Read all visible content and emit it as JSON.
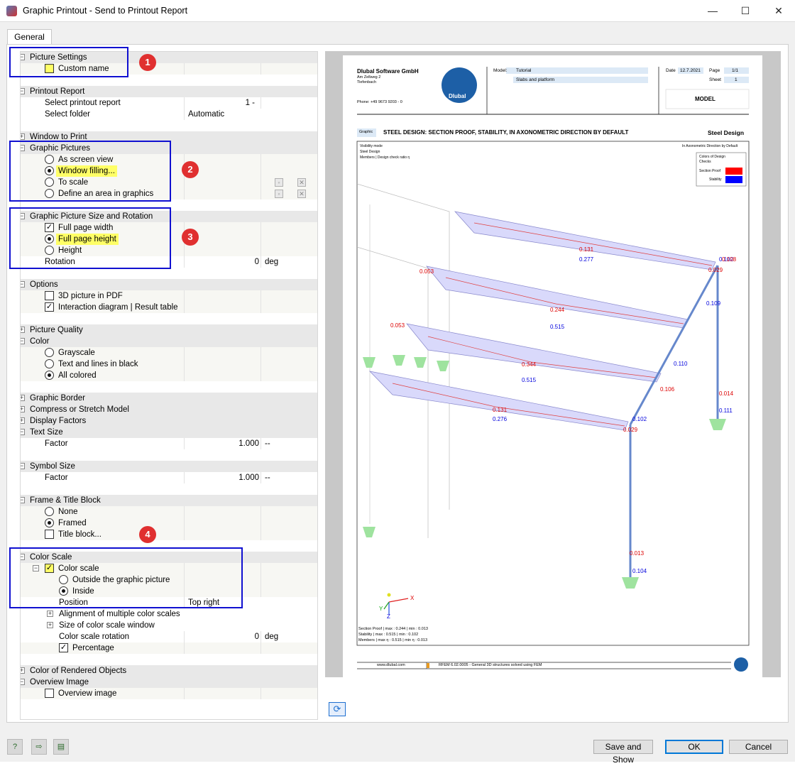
{
  "window": {
    "title": "Graphic Printout - Send to Printout Report",
    "minimize": "—",
    "maximize": "☐",
    "close": "✕"
  },
  "tab": "General",
  "tree": {
    "picture_settings": "Picture Settings",
    "custom_name": "Custom name",
    "printout_report": "Printout Report",
    "select_printout_report": "Select printout report",
    "select_printout_report_value": "1 -",
    "select_folder": "Select folder",
    "select_folder_value": "Automatic",
    "window_to_print": "Window to Print",
    "graphic_pictures": "Graphic Pictures",
    "as_screen_view": "As screen view",
    "window_filling": "Window filling...",
    "to_scale": "To scale",
    "define_area": "Define an area in graphics",
    "size_rotation": "Graphic Picture Size and Rotation",
    "full_page_width": "Full page width",
    "full_page_height": "Full page height",
    "height": "Height",
    "rotation": "Rotation",
    "rotation_value": "0",
    "rotation_unit": "deg",
    "options": "Options",
    "pdf_3d": "3D picture in PDF",
    "interaction_diagram": "Interaction diagram | Result table",
    "picture_quality": "Picture Quality",
    "color": "Color",
    "grayscale": "Grayscale",
    "text_lines_black": "Text and lines in black",
    "all_colored": "All colored",
    "graphic_border": "Graphic Border",
    "compress_stretch": "Compress or Stretch Model",
    "display_factors": "Display Factors",
    "text_size": "Text Size",
    "text_factor": "Factor",
    "text_factor_value": "1.000",
    "text_factor_unit": "--",
    "symbol_size": "Symbol Size",
    "symbol_factor": "Factor",
    "symbol_factor_value": "1.000",
    "symbol_factor_unit": "--",
    "frame_title_block": "Frame & Title Block",
    "none": "None",
    "framed": "Framed",
    "title_block": "Title block...",
    "color_scale_section": "Color Scale",
    "color_scale": "Color scale",
    "outside_graphic": "Outside the graphic picture",
    "inside": "Inside",
    "position": "Position",
    "position_value": "Top right",
    "alignment_multiple": "Alignment of multiple color scales",
    "size_color_scale_window": "Size of color scale window",
    "color_scale_rotation": "Color scale rotation",
    "color_scale_rotation_value": "0",
    "color_scale_rotation_unit": "deg",
    "percentage": "Percentage",
    "color_rendered_objects": "Color of Rendered Objects",
    "overview_image": "Overview Image",
    "overview_image_item": "Overview image"
  },
  "badges": [
    "1",
    "2",
    "3",
    "4"
  ],
  "report": {
    "company": "Dlubal Software GmbH",
    "address1": "Am Zellweg 2",
    "address2": "Tiefenbach",
    "phone": "Phone: +49 9673 9203 - 0",
    "logo": "Dlubal",
    "model_label": "Model:",
    "model_value": "Tutorial",
    "model_desc": "Slabs and platform",
    "date_label": "Date",
    "date_value": "12.7.2021",
    "page_label": "Page",
    "page_value": "1/1",
    "sheet_label": "Sheet",
    "sheet_value": "1",
    "model_title": "MODEL",
    "graphic_tag": "Graphic",
    "graphic_title": "STEEL DESIGN: SECTION PROOF, STABILITY, IN AXONOMETRIC DIRECTION BY DEFAULT",
    "graphic_right": "Steel Design",
    "vis1": "Visibility mode",
    "vis2": "Steel Design",
    "vis3": "Members | Design check ratio η",
    "direction": "In Axonometric Direction by Default",
    "legend_title1": "Colors of Design",
    "legend_title2": "Checks",
    "legend_section": "Section Proof",
    "legend_stability": "Stability",
    "footer1": "Section Proof | max : 0.244 | min : 0.013",
    "footer2": "Stability | max : 0.515 | min : 0.102",
    "footer3": "Members | max η : 0.515 | min η : 0.013",
    "web": "www.dlubal.com",
    "software": "RFEM 6.02.0005 - General 3D structures solved using FEM",
    "axis_x": "X",
    "axis_y": "Y",
    "axis_z": "Z",
    "labels": [
      "0.131",
      "0.277",
      "0.053",
      "0.244",
      "0.515",
      "0.053",
      "0.344",
      "0.515",
      "0.131",
      "0.276",
      "0.029",
      "0.102",
      "0.106",
      "0.110",
      "0.109",
      "0.014",
      "0.111",
      "0.013",
      "0.104",
      "0.102",
      "0.029",
      "0.108"
    ]
  },
  "buttons": {
    "save_and_show": "Save and Show",
    "ok": "OK",
    "cancel": "Cancel"
  },
  "colors": {
    "section_proof": "#ff0000",
    "stability": "#0000ff",
    "highlight": "#ffff66",
    "annotation_box": "#1010d0",
    "badge": "#e03030"
  }
}
